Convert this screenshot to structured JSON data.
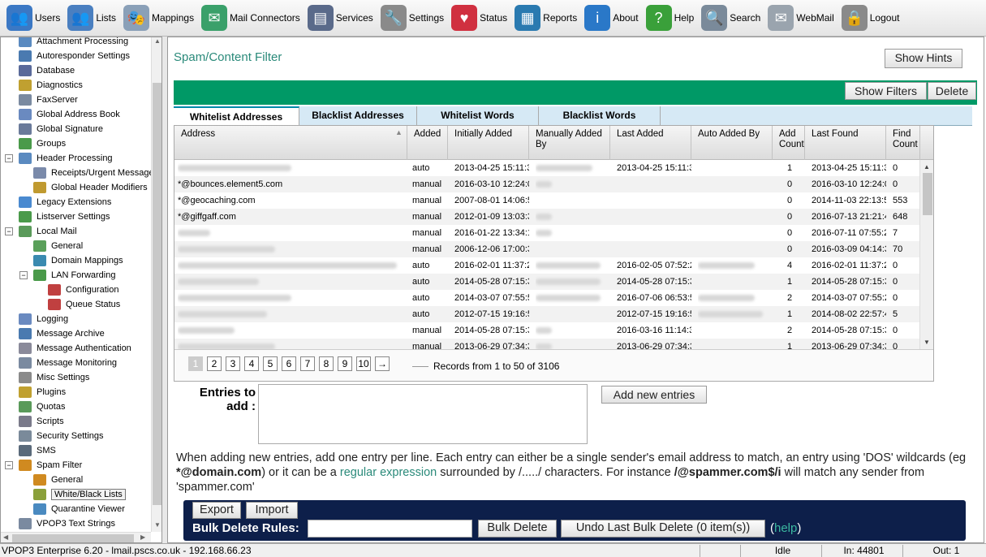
{
  "toolbar": [
    {
      "label": "Users",
      "icon": "users-icon",
      "color": "#3b78c4",
      "glyph": "👥"
    },
    {
      "label": "Lists",
      "icon": "lists-icon",
      "color": "#4a7fc0",
      "glyph": "👥"
    },
    {
      "label": "Mappings",
      "icon": "mappings-icon",
      "color": "#8aa0b8",
      "glyph": "🎭"
    },
    {
      "label": "Mail Connectors",
      "icon": "mail-connectors-icon",
      "color": "#3aa06a",
      "glyph": "✉"
    },
    {
      "label": "Services",
      "icon": "services-icon",
      "color": "#5a6a8a",
      "glyph": "▤"
    },
    {
      "label": "Settings",
      "icon": "settings-icon",
      "color": "#8a8a8a",
      "glyph": "🔧"
    },
    {
      "label": "Status",
      "icon": "status-icon",
      "color": "#d03040",
      "glyph": "♥"
    },
    {
      "label": "Reports",
      "icon": "reports-icon",
      "color": "#2a7ab0",
      "glyph": "▦"
    },
    {
      "label": "About",
      "icon": "about-icon",
      "color": "#2a78c8",
      "glyph": "i"
    },
    {
      "label": "Help",
      "icon": "help-icon",
      "color": "#3aa03a",
      "glyph": "?"
    },
    {
      "label": "Search",
      "icon": "search-icon",
      "color": "#7a8a9a",
      "glyph": "🔍"
    },
    {
      "label": "WebMail",
      "icon": "webmail-icon",
      "color": "#9aa4ae",
      "glyph": "✉"
    },
    {
      "label": "Logout",
      "icon": "logout-icon",
      "color": "#8a8a8a",
      "glyph": "🔒"
    }
  ],
  "tree": [
    {
      "label": "Attachment Processing",
      "indent": 1,
      "color": "#5a8ac0",
      "icon": "attachment-icon"
    },
    {
      "label": "Autoresponder Settings",
      "indent": 1,
      "color": "#4a7ab0",
      "icon": "autoresponder-icon"
    },
    {
      "label": "Database",
      "indent": 1,
      "color": "#5a6a9a",
      "icon": "database-icon"
    },
    {
      "label": "Diagnostics",
      "indent": 1,
      "color": "#c0a030",
      "icon": "diagnostics-icon"
    },
    {
      "label": "FaxServer",
      "indent": 1,
      "color": "#7a8aa0",
      "icon": "fax-icon"
    },
    {
      "label": "Global Address Book",
      "indent": 1,
      "color": "#6a8ac0",
      "icon": "address-book-icon"
    },
    {
      "label": "Global Signature",
      "indent": 1,
      "color": "#6a7a9a",
      "icon": "signature-icon"
    },
    {
      "label": "Groups",
      "indent": 1,
      "color": "#4a9a4a",
      "icon": "groups-icon"
    },
    {
      "label": "Header Processing",
      "indent": 1,
      "color": "#5a8ac0",
      "icon": "header-icon",
      "toggle": "−"
    },
    {
      "label": "Receipts/Urgent Messages",
      "indent": 2,
      "color": "#7a8aaa",
      "icon": "receipts-icon"
    },
    {
      "label": "Global Header Modifiers",
      "indent": 2,
      "color": "#c09a30",
      "icon": "header-modifiers-icon"
    },
    {
      "label": "Legacy Extensions",
      "indent": 1,
      "color": "#4a8ad0",
      "icon": "legacy-icon"
    },
    {
      "label": "Listserver Settings",
      "indent": 1,
      "color": "#4a9a4a",
      "icon": "listserver-icon"
    },
    {
      "label": "Local Mail",
      "indent": 1,
      "color": "#5a9a5a",
      "icon": "local-mail-icon",
      "toggle": "−"
    },
    {
      "label": "General",
      "indent": 2,
      "color": "#5aa05a",
      "icon": "general-icon"
    },
    {
      "label": "Domain Mappings",
      "indent": 2,
      "color": "#3a8ab0",
      "icon": "domain-mappings-icon"
    },
    {
      "label": "LAN Forwarding",
      "indent": 2,
      "color": "#4a9a4a",
      "icon": "lan-forwarding-icon",
      "toggle": "−"
    },
    {
      "label": "Configuration",
      "indent": 3,
      "color": "#c04040",
      "icon": "configuration-icon"
    },
    {
      "label": "Queue Status",
      "indent": 3,
      "color": "#c04040",
      "icon": "queue-status-icon"
    },
    {
      "label": "Logging",
      "indent": 1,
      "color": "#6a8ac0",
      "icon": "logging-icon"
    },
    {
      "label": "Message Archive",
      "indent": 1,
      "color": "#4a7ab0",
      "icon": "archive-icon"
    },
    {
      "label": "Message Authentication",
      "indent": 1,
      "color": "#8a8a9a",
      "icon": "authentication-icon"
    },
    {
      "label": "Message Monitoring",
      "indent": 1,
      "color": "#7a8aa0",
      "icon": "monitoring-icon"
    },
    {
      "label": "Misc Settings",
      "indent": 1,
      "color": "#8a8a8a",
      "icon": "misc-icon"
    },
    {
      "label": "Plugins",
      "indent": 1,
      "color": "#c0a030",
      "icon": "plugins-icon"
    },
    {
      "label": "Quotas",
      "indent": 1,
      "color": "#5a9a5a",
      "icon": "quotas-icon"
    },
    {
      "label": "Scripts",
      "indent": 1,
      "color": "#7a7a8a",
      "icon": "scripts-icon"
    },
    {
      "label": "Security Settings",
      "indent": 1,
      "color": "#7a8a9a",
      "icon": "security-icon"
    },
    {
      "label": "SMS",
      "indent": 1,
      "color": "#5a6a7a",
      "icon": "sms-icon"
    },
    {
      "label": "Spam Filter",
      "indent": 1,
      "color": "#d08a20",
      "icon": "spam-filter-icon",
      "toggle": "−"
    },
    {
      "label": "General",
      "indent": 2,
      "color": "#d08a20",
      "icon": "spam-general-icon"
    },
    {
      "label": "White/Black Lists",
      "indent": 2,
      "color": "#8aa03a",
      "icon": "white-black-lists-icon",
      "selected": true
    },
    {
      "label": "Quarantine Viewer",
      "indent": 2,
      "color": "#4a8ac0",
      "icon": "quarantine-icon"
    },
    {
      "label": "VPOP3 Text Strings",
      "indent": 1,
      "color": "#7a8aa0",
      "icon": "text-strings-icon"
    }
  ],
  "main": {
    "title": "Spam/Content Filter",
    "show_hints": "Show Hints",
    "show_filters": "Show Filters",
    "delete": "Delete"
  },
  "tabs": [
    "Whitelist Addresses",
    "Blacklist Addresses",
    "Whitelist Words",
    "Blacklist Words"
  ],
  "grid": {
    "columns": [
      {
        "label": "Address"
      },
      {
        "label": "Added"
      },
      {
        "label": "Initially Added"
      },
      {
        "label": "Manually Added By"
      },
      {
        "label": "Last Added"
      },
      {
        "label": "Auto Added By"
      },
      {
        "label": "Add Count"
      },
      {
        "label": "Last Found"
      },
      {
        "label": "Find Count"
      }
    ],
    "rows": [
      {
        "address": "",
        "added": "auto",
        "initially": "2013-04-25 15:11:3",
        "manual_by": "",
        "last_added": "2013-04-25 15:11:3",
        "auto_by": "",
        "add_count": "1",
        "last_found": "2013-04-25 15:11:3",
        "find_count": "0",
        "blur": [
          140,
          0,
          70,
          0,
          0
        ]
      },
      {
        "address": "*@bounces.element5.com",
        "added": "manual",
        "initially": "2016-03-10 12:24:0",
        "manual_by": "",
        "last_added": "",
        "auto_by": "",
        "add_count": "0",
        "last_found": "2016-03-10 12:24:0",
        "find_count": "0",
        "blur": [
          0,
          0,
          20,
          0,
          0
        ]
      },
      {
        "address": "*@geocaching.com",
        "added": "manual",
        "initially": "2007-08-01 14:06:5",
        "manual_by": "",
        "last_added": "",
        "auto_by": "",
        "add_count": "0",
        "last_found": "2014-11-03 22:13:5",
        "find_count": "553",
        "blur": [
          0,
          0,
          0,
          0,
          0
        ]
      },
      {
        "address": "*@giffgaff.com",
        "added": "manual",
        "initially": "2012-01-09 13:03:3",
        "manual_by": "",
        "last_added": "",
        "auto_by": "",
        "add_count": "0",
        "last_found": "2016-07-13 21:21:4",
        "find_count": "648",
        "blur": [
          0,
          0,
          20,
          0,
          0
        ]
      },
      {
        "address": "",
        "added": "manual",
        "initially": "2016-01-22 13:34:1",
        "manual_by": "",
        "last_added": "",
        "auto_by": "",
        "add_count": "0",
        "last_found": "2016-07-11 07:55:2",
        "find_count": "7",
        "blur": [
          40,
          0,
          20,
          0,
          0
        ]
      },
      {
        "address": "",
        "added": "manual",
        "initially": "2006-12-06 17:00:3",
        "manual_by": "",
        "last_added": "",
        "auto_by": "",
        "add_count": "0",
        "last_found": "2016-03-09 04:14:3",
        "find_count": "70",
        "blur": [
          120,
          0,
          0,
          0,
          0
        ]
      },
      {
        "address": "",
        "added": "auto",
        "initially": "2016-02-01 11:37:2",
        "manual_by": "",
        "last_added": "2016-02-05 07:52:2",
        "auto_by": "",
        "add_count": "4",
        "last_found": "2016-02-01 11:37:2",
        "find_count": "0",
        "blur": [
          270,
          0,
          80,
          0,
          70
        ]
      },
      {
        "address": "",
        "added": "auto",
        "initially": "2014-05-28 07:15:3",
        "manual_by": "",
        "last_added": "2014-05-28 07:15:3",
        "auto_by": "",
        "add_count": "1",
        "last_found": "2014-05-28 07:15:3",
        "find_count": "0",
        "blur": [
          100,
          0,
          80,
          0,
          0
        ]
      },
      {
        "address": "",
        "added": "auto",
        "initially": "2014-03-07 07:55:5",
        "manual_by": "",
        "last_added": "2016-07-06 06:53:5",
        "auto_by": "",
        "add_count": "2",
        "last_found": "2014-03-07 07:55:2",
        "find_count": "0",
        "blur": [
          140,
          0,
          80,
          0,
          70
        ]
      },
      {
        "address": "",
        "added": "auto",
        "initially": "2012-07-15 19:16:5",
        "manual_by": "",
        "last_added": "2012-07-15 19:16:5",
        "auto_by": "",
        "add_count": "1",
        "last_found": "2014-08-02 22:57:4",
        "find_count": "5",
        "blur": [
          110,
          0,
          0,
          0,
          80
        ]
      },
      {
        "address": "",
        "added": "manual",
        "initially": "2014-05-28 07:15:3",
        "manual_by": "",
        "last_added": "2016-03-16 11:14:3",
        "auto_by": "",
        "add_count": "2",
        "last_found": "2014-05-28 07:15:3",
        "find_count": "0",
        "blur": [
          70,
          0,
          20,
          0,
          0
        ]
      },
      {
        "address": "",
        "added": "manual",
        "initially": "2013-06-29 07:34:3",
        "manual_by": "",
        "last_added": "2013-06-29 07:34:3",
        "auto_by": "",
        "add_count": "1",
        "last_found": "2013-06-29 07:34:3",
        "find_count": "0",
        "blur": [
          120,
          0,
          20,
          0,
          0
        ]
      }
    ],
    "pages": [
      "1",
      "2",
      "3",
      "4",
      "5",
      "6",
      "7",
      "8",
      "9",
      "10",
      "→"
    ],
    "records": "Records from 1 to 50 of 3106"
  },
  "entries": {
    "label": "Entries to add :",
    "add_button": "Add new entries"
  },
  "help": {
    "part1": "When adding new entries, add one entry per line. Each entry can either be a single sender's email address to match, an entry using 'DOS' wildcards (eg ",
    "example1": "*@domain.com",
    "part2": ") or it can be a ",
    "link": "regular expression",
    "part3": " surrounded by /...../ characters. For instance ",
    "example2": "/@spammer.com$/i",
    "part4": " will match any sender from 'spammer.com'"
  },
  "bulk": {
    "export": "Export",
    "import": "Import",
    "rules_label": "Bulk Delete Rules:",
    "bulk_delete": "Bulk Delete",
    "undo": "Undo Last Bulk Delete (0 item(s))",
    "help_open": "(",
    "help_link": "help",
    "help_close": ")"
  },
  "status": {
    "version": "VPOP3 Enterprise 6.20 - lmail.pscs.co.uk - 192.168.66.23",
    "state": "Idle",
    "in": "In: 44801",
    "out": "Out: 1"
  }
}
